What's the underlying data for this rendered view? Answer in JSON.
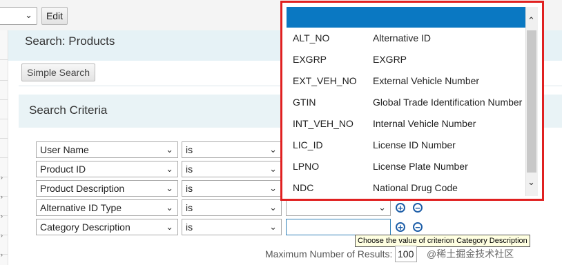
{
  "toolbar": {
    "edit_label": "Edit"
  },
  "page": {
    "title": "Search: Products",
    "simple_search_label": "Simple Search",
    "criteria_title": "Search Criteria"
  },
  "criteria_rows": [
    {
      "field": "User Name",
      "operator": "is",
      "value": ""
    },
    {
      "field": "Product ID",
      "operator": "is",
      "value": ""
    },
    {
      "field": "Product Description",
      "operator": "is",
      "value": ""
    },
    {
      "field": "Alternative ID Type",
      "operator": "is",
      "value": ""
    },
    {
      "field": "Category Description",
      "operator": "is",
      "value": ""
    }
  ],
  "tooltip": "Choose the value of criterion Category Description",
  "max_results": {
    "label": "Maximum Number of Results:",
    "value": "100"
  },
  "dropdown": {
    "selected": "",
    "options": [
      {
        "code": "ALT_NO",
        "desc": "Alternative ID"
      },
      {
        "code": "EXGRP",
        "desc": "EXGRP"
      },
      {
        "code": "EXT_VEH_NO",
        "desc": "External Vehicle Number"
      },
      {
        "code": "GTIN",
        "desc": "Global Trade Identification Number"
      },
      {
        "code": "INT_VEH_NO",
        "desc": "Internal Vehicle Number"
      },
      {
        "code": "LIC_ID",
        "desc": "License ID Number"
      },
      {
        "code": "LPNO",
        "desc": "License Plate Number"
      },
      {
        "code": "NDC",
        "desc": "National Drug Code"
      }
    ]
  },
  "watermark": "@稀土掘金技术社区",
  "colors": {
    "accent": "#0a78c2",
    "highlight_frame": "#e02020",
    "band": "#e6f2f6",
    "icon": "#1f5fa8"
  }
}
